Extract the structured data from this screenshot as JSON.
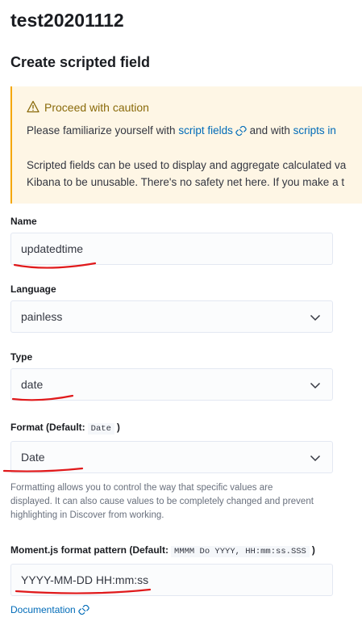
{
  "page": {
    "title": "test20201112",
    "section_title": "Create scripted field"
  },
  "callout": {
    "title": "Proceed with caution",
    "line1_text": "Please familiarize yourself with ",
    "line1_link1": "script fields",
    "line1_mid": " and with ",
    "line1_link2": "scripts in",
    "line2": "Scripted fields can be used to display and aggregate calculated va",
    "line3": "Kibana to be unusable. There's no safety net here. If you make a t",
    "accent_color": "#f5a700",
    "background_color": "#fef6e5"
  },
  "form": {
    "name": {
      "label": "Name",
      "value": "updatedtime"
    },
    "language": {
      "label": "Language",
      "value": "painless"
    },
    "type": {
      "label": "Type",
      "value": "date"
    },
    "format": {
      "label_prefix": "Format (Default:",
      "label_code": "Date",
      "label_suffix": ")",
      "value": "Date",
      "help": "Formatting allows you to control the way that specific values are displayed. It can also cause values to be completely changed and prevent highlighting in Discover from working."
    },
    "pattern": {
      "label_prefix": "Moment.js format pattern (Default:",
      "label_code": "MMMM Do YYYY, HH:mm:ss.SSS",
      "label_suffix": ")",
      "value": "YYYY-MM-DD HH:mm:ss"
    },
    "documentation_link": "Documentation"
  },
  "icons": {
    "warning": "warning-icon",
    "external_link": "popout-link-icon",
    "dropdown": "chevron-down-icon"
  },
  "annotation_color": "#e0191b"
}
